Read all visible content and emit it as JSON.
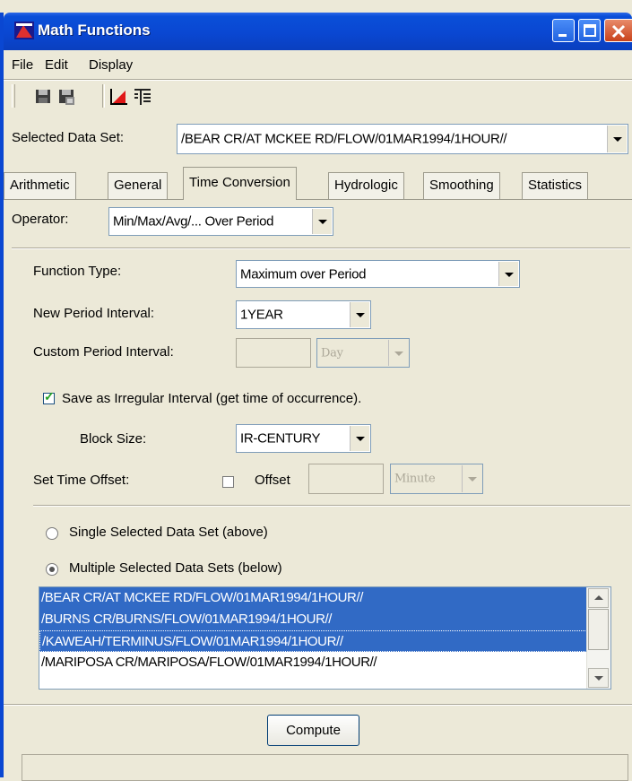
{
  "window": {
    "title": "Math Functions"
  },
  "menu": {
    "file": "File",
    "edit": "Edit",
    "display": "Display"
  },
  "toolbar": {
    "icons": [
      "save-icon",
      "save-as-icon",
      "plot-icon",
      "table-icon"
    ]
  },
  "selected_data_set": {
    "label": "Selected Data Set:",
    "value": "/BEAR CR/AT MCKEE RD/FLOW/01MAR1994/1HOUR//"
  },
  "tabs": [
    "Arithmetic",
    "General",
    "Time Conversion",
    "Hydrologic",
    "Smoothing",
    "Statistics"
  ],
  "active_tab": "Time Conversion",
  "operator": {
    "label": "Operator:",
    "value": "Min/Max/Avg/... Over Period"
  },
  "function_type": {
    "label": "Function Type:",
    "value": "Maximum over Period"
  },
  "new_period_interval": {
    "label": "New Period Interval:",
    "value": "1YEAR"
  },
  "custom_period_interval": {
    "label": "Custom Period Interval:",
    "value": "",
    "unit": "Day"
  },
  "irregular": {
    "label": "Save as Irregular Interval (get time of occurrence).",
    "checked": true
  },
  "block_size": {
    "label": "Block Size:",
    "value": "IR-CENTURY"
  },
  "time_offset": {
    "label": "Set Time Offset:",
    "checkbox_label": "Offset",
    "checked": false,
    "value": "",
    "unit": "Minute"
  },
  "selection_mode": {
    "single": "Single Selected Data Set (above)",
    "multiple": "Multiple Selected Data Sets (below)",
    "selected": "multiple"
  },
  "data_sets": [
    "/BEAR CR/AT MCKEE RD/FLOW/01MAR1994/1HOUR//",
    "/BURNS CR/BURNS/FLOW/01MAR1994/1HOUR//",
    "/KAWEAH/TERMINUS/FLOW/01MAR1994/1HOUR//",
    "/MARIPOSA CR/MARIPOSA/FLOW/01MAR1994/1HOUR//"
  ],
  "selected_rows": [
    0,
    1,
    2
  ],
  "compute_label": "Compute",
  "status": ""
}
